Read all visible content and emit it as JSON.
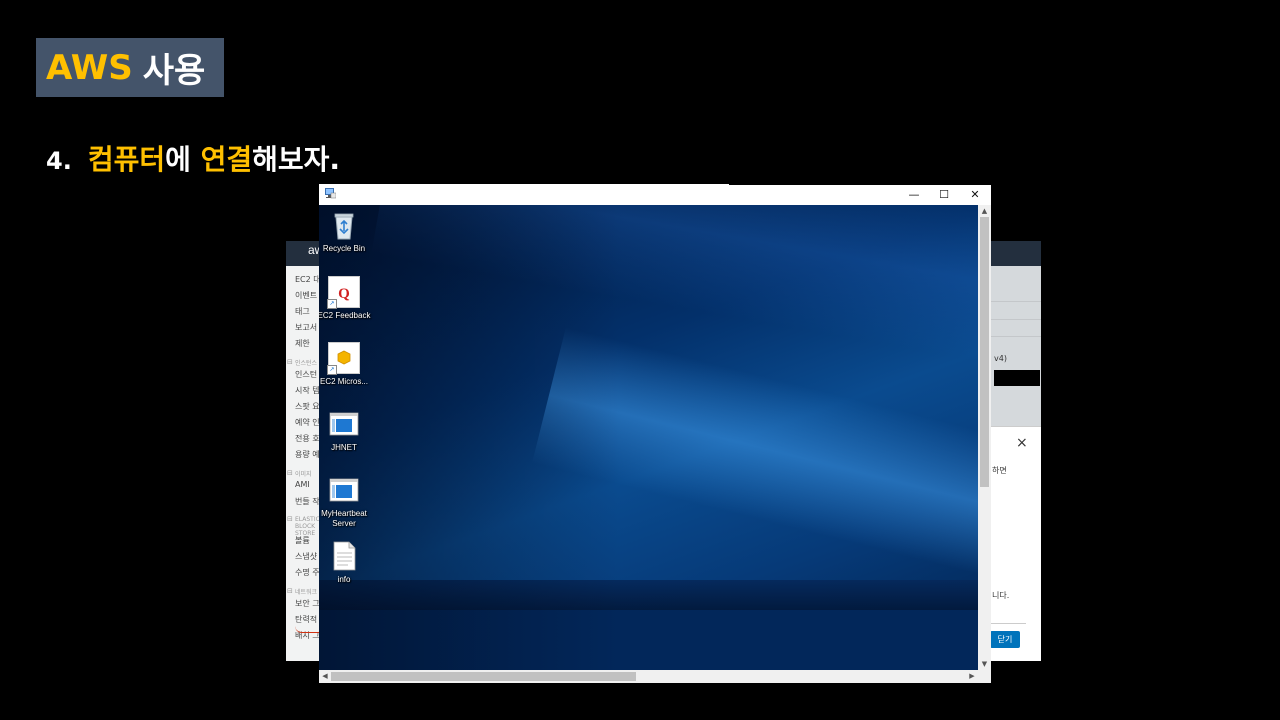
{
  "slide": {
    "title_accent": "AWS",
    "title_rest": "사용",
    "step_number": "4.",
    "step_part1": "컴퓨터",
    "step_part2": "에 ",
    "step_part3": "연결",
    "step_part4": "해보자."
  },
  "console": {
    "logo": "aws",
    "sidebar_items": [
      {
        "label": "EC2 대",
        "type": "item"
      },
      {
        "label": "이벤트",
        "type": "item"
      },
      {
        "label": "태그",
        "type": "item"
      },
      {
        "label": "보고서",
        "type": "item"
      },
      {
        "label": "제한",
        "type": "item"
      },
      {
        "label": "인스턴스",
        "type": "section"
      },
      {
        "label": "인스턴",
        "type": "item"
      },
      {
        "label": "시작 템",
        "type": "item"
      },
      {
        "label": "스팟 요",
        "type": "item"
      },
      {
        "label": "예약 인",
        "type": "item"
      },
      {
        "label": "전용 호",
        "type": "item"
      },
      {
        "label": "용량 예",
        "type": "item"
      },
      {
        "label": "이미지",
        "type": "section"
      },
      {
        "label": "AMI",
        "type": "item"
      },
      {
        "label": "번들 작",
        "type": "item"
      },
      {
        "label": "ELASTIC BLOCK STORE",
        "type": "section"
      },
      {
        "label": "볼륨",
        "type": "item"
      },
      {
        "label": "스냅샷",
        "type": "item"
      },
      {
        "label": "수명 주",
        "type": "item"
      },
      {
        "label": "네트워크",
        "type": "section"
      },
      {
        "label": "보안 그",
        "type": "item"
      },
      {
        "label": "탄력적",
        "type": "item"
      },
      {
        "label": "배치 그",
        "type": "item"
      }
    ],
    "right_text": "v4)",
    "dialog_text1": "하면",
    "dialog_text2": "니다.",
    "dialog_close_button": "닫기",
    "dialog_close_icon": "×"
  },
  "rdp": {
    "window_controls": {
      "minimize": "—",
      "maximize": "☐",
      "close": "✕"
    },
    "desktop_icons": [
      {
        "label": "Recycle Bin",
        "icon": "recycle-bin-icon"
      },
      {
        "label": "EC2 Feedback",
        "icon": "ec2-feedback-icon"
      },
      {
        "label": "EC2 Micros...",
        "icon": "ec2-microsoft-icon"
      },
      {
        "label": "JHNET",
        "icon": "window-app-icon"
      },
      {
        "label": "MyHeartbeat Server",
        "icon": "window-app-icon"
      },
      {
        "label": "info",
        "icon": "text-file-icon"
      }
    ]
  },
  "colors": {
    "accent": "#ffc000",
    "badge_bg": "#44546a",
    "aws_blue": "#0073bb"
  }
}
